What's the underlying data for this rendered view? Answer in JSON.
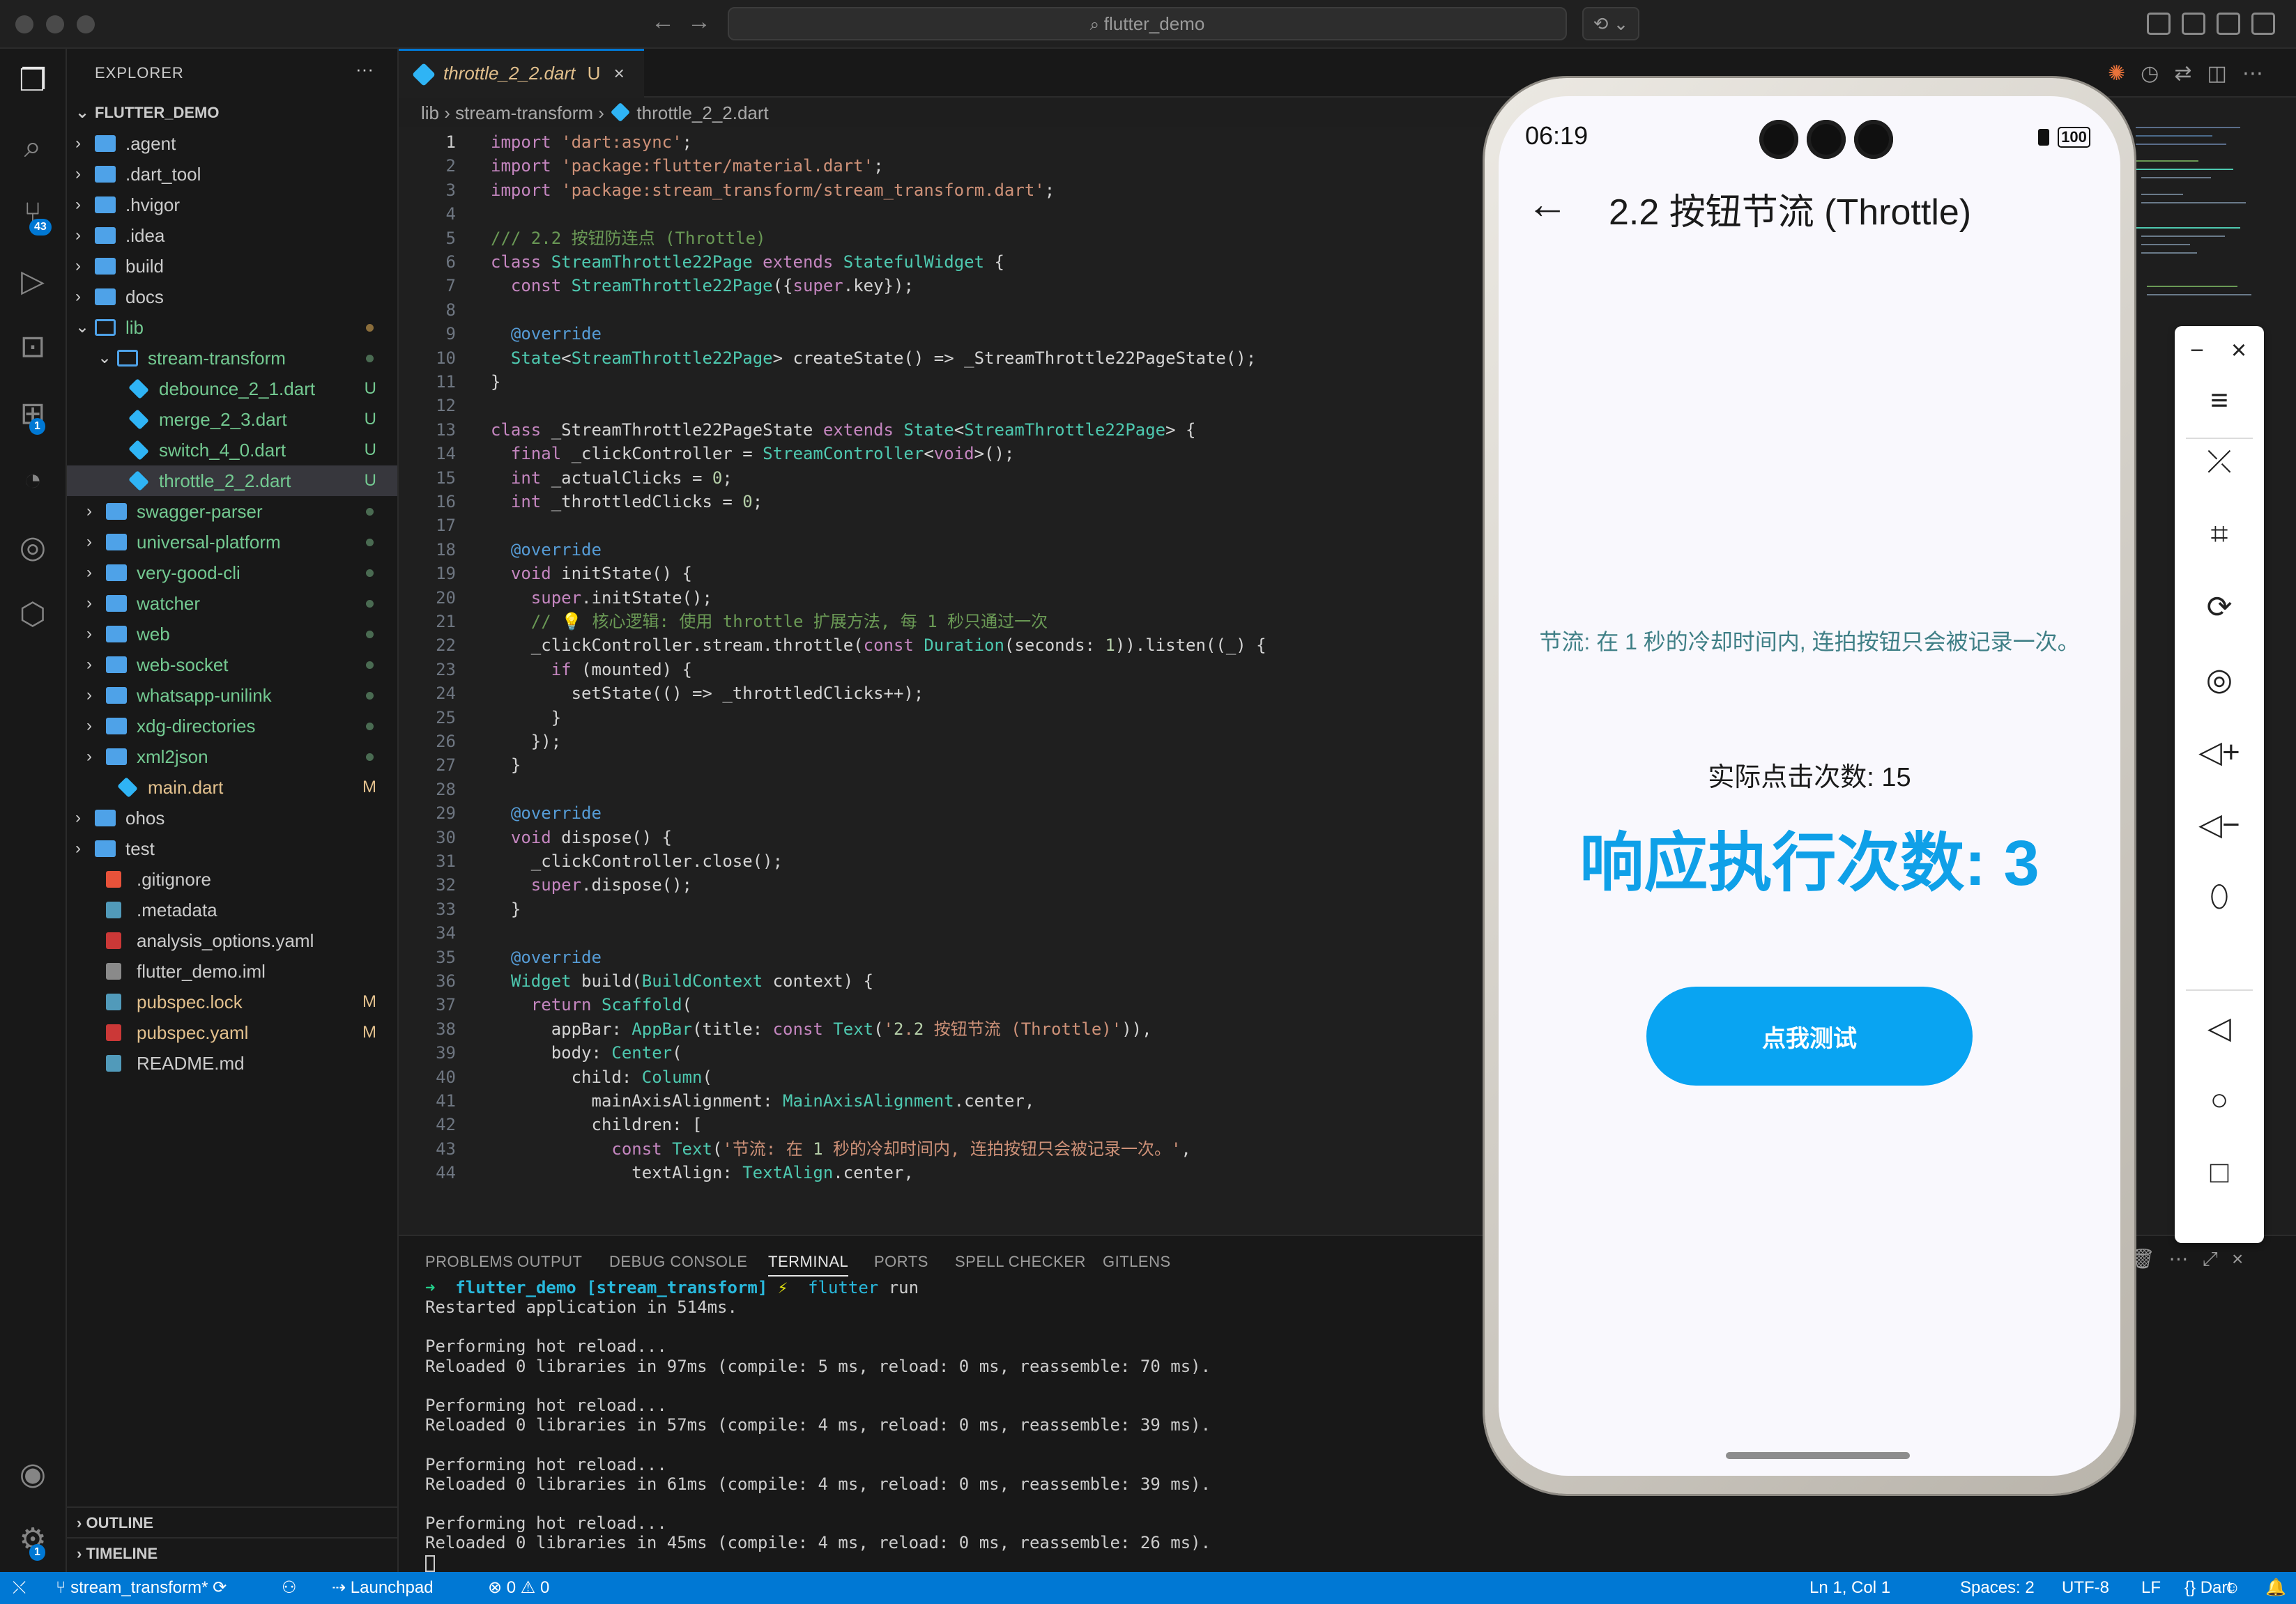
{
  "window": {
    "search": "flutter_demo"
  },
  "explorer": {
    "title": "EXPLORER",
    "more": "···",
    "root": "FLUTTER_DEMO",
    "items": [
      {
        "label": ".agent",
        "status": ""
      },
      {
        "label": ".dart_tool",
        "status": ""
      },
      {
        "label": ".hvigor",
        "status": ""
      },
      {
        "label": ".idea",
        "status": ""
      },
      {
        "label": "build",
        "status": ""
      },
      {
        "label": "docs",
        "status": ""
      },
      {
        "label": "lib",
        "status": ""
      },
      {
        "label": "stream-transform",
        "status": ""
      },
      {
        "label": "debounce_2_1.dart",
        "status": "U"
      },
      {
        "label": "merge_2_3.dart",
        "status": "U"
      },
      {
        "label": "switch_4_0.dart",
        "status": "U"
      },
      {
        "label": "throttle_2_2.dart",
        "status": "U"
      },
      {
        "label": "swagger-parser",
        "status": ""
      },
      {
        "label": "universal-platform",
        "status": ""
      },
      {
        "label": "very-good-cli",
        "status": ""
      },
      {
        "label": "watcher",
        "status": ""
      },
      {
        "label": "web",
        "status": ""
      },
      {
        "label": "web-socket",
        "status": ""
      },
      {
        "label": "whatsapp-unilink",
        "status": ""
      },
      {
        "label": "xdg-directories",
        "status": ""
      },
      {
        "label": "xml2json",
        "status": ""
      },
      {
        "label": "main.dart",
        "status": "M"
      },
      {
        "label": "ohos",
        "status": ""
      },
      {
        "label": "test",
        "status": ""
      },
      {
        "label": ".gitignore",
        "status": ""
      },
      {
        "label": ".metadata",
        "status": ""
      },
      {
        "label": "analysis_options.yaml",
        "status": ""
      },
      {
        "label": "flutter_demo.iml",
        "status": ""
      },
      {
        "label": "pubspec.lock",
        "status": "M"
      },
      {
        "label": "pubspec.yaml",
        "status": "M"
      },
      {
        "label": "README.md",
        "status": ""
      }
    ],
    "outline": "OUTLINE",
    "timeline": "TIMELINE"
  },
  "badges": {
    "scm": "43",
    "extensions": "1",
    "settings": "1"
  },
  "tab": {
    "name": "throttle_2_2.dart",
    "status": "U",
    "close": "×"
  },
  "breadcrumbs": {
    "b1": "lib",
    "b2": "stream-transform",
    "b3": "throttle_2_2.dart"
  },
  "code": [
    {
      "n": "1",
      "t": "import 'dart:async';"
    },
    {
      "n": "2",
      "t": "import 'package:flutter/material.dart';"
    },
    {
      "n": "3",
      "t": "import 'package:stream_transform/stream_transform.dart';"
    },
    {
      "n": "4",
      "t": ""
    },
    {
      "n": "5",
      "t": "/// 2.2 按钮防连点 (Throttle)"
    },
    {
      "n": "6",
      "t": "class StreamThrottle22Page extends StatefulWidget {"
    },
    {
      "n": "7",
      "t": "  const StreamThrottle22Page({super.key});"
    },
    {
      "n": "8",
      "t": ""
    },
    {
      "n": "9",
      "t": "  @override"
    },
    {
      "n": "10",
      "t": "  State<StreamThrottle22Page> createState() => _StreamThrottle22PageState();"
    },
    {
      "n": "11",
      "t": "}"
    },
    {
      "n": "12",
      "t": ""
    },
    {
      "n": "13",
      "t": "class _StreamThrottle22PageState extends State<StreamThrottle22Page> {"
    },
    {
      "n": "14",
      "t": "  final _clickController = StreamController<void>();"
    },
    {
      "n": "15",
      "t": "  int _actualClicks = 0;"
    },
    {
      "n": "16",
      "t": "  int _throttledClicks = 0;"
    },
    {
      "n": "17",
      "t": ""
    },
    {
      "n": "18",
      "t": "  @override"
    },
    {
      "n": "19",
      "t": "  void initState() {"
    },
    {
      "n": "20",
      "t": "    super.initState();"
    },
    {
      "n": "21",
      "t": "    // 💡 核心逻辑: 使用 throttle 扩展方法, 每 1 秒只通过一次"
    },
    {
      "n": "22",
      "t": "    _clickController.stream.throttle(const Duration(seconds: 1)).listen((_) {"
    },
    {
      "n": "23",
      "t": "      if (mounted) {"
    },
    {
      "n": "24",
      "t": "        setState(() => _throttledClicks++);"
    },
    {
      "n": "25",
      "t": "      }"
    },
    {
      "n": "26",
      "t": "    });"
    },
    {
      "n": "27",
      "t": "  }"
    },
    {
      "n": "28",
      "t": ""
    },
    {
      "n": "29",
      "t": "  @override"
    },
    {
      "n": "30",
      "t": "  void dispose() {"
    },
    {
      "n": "31",
      "t": "    _clickController.close();"
    },
    {
      "n": "32",
      "t": "    super.dispose();"
    },
    {
      "n": "33",
      "t": "  }"
    },
    {
      "n": "34",
      "t": ""
    },
    {
      "n": "35",
      "t": "  @override"
    },
    {
      "n": "36",
      "t": "  Widget build(BuildContext context) {"
    },
    {
      "n": "37",
      "t": "    return Scaffold("
    },
    {
      "n": "38",
      "t": "      appBar: AppBar(title: const Text('2.2 按钮节流 (Throttle)')),"
    },
    {
      "n": "39",
      "t": "      body: Center("
    },
    {
      "n": "40",
      "t": "        child: Column("
    },
    {
      "n": "41",
      "t": "          mainAxisAlignment: MainAxisAlignment.center,"
    },
    {
      "n": "42",
      "t": "          children: ["
    },
    {
      "n": "43",
      "t": "            const Text('节流: 在 1 秒的冷却时间内, 连拍按钮只会被记录一次。',"
    },
    {
      "n": "44",
      "t": "              textAlign: TextAlign.center,"
    }
  ],
  "panel": {
    "tabs": [
      "PROBLEMS",
      "OUTPUT",
      "DEBUG CONSOLE",
      "TERMINAL",
      "PORTS",
      "SPELL CHECKER",
      "GITLENS"
    ],
    "prompt_arrow": "➜",
    "prompt_dir": "flutter_demo",
    "prompt_branch": "[stream_transform]",
    "prompt_bolt": "⚡",
    "prompt_cmd": "flutter",
    "prompt_arg": "run",
    "lines": [
      "Restarted application in 514ms.",
      "",
      "Performing hot reload...",
      "Reloaded 0 libraries in 97ms (compile: 5 ms, reload: 0 ms, reassemble: 70 ms).",
      "",
      "Performing hot reload...",
      "Reloaded 0 libraries in 57ms (compile: 4 ms, reload: 0 ms, reassemble: 39 ms).",
      "",
      "Performing hot reload...",
      "Reloaded 0 libraries in 61ms (compile: 4 ms, reload: 0 ms, reassemble: 39 ms).",
      "",
      "Performing hot reload...",
      "Reloaded 0 libraries in 45ms (compile: 4 ms, reload: 0 ms, reassemble: 26 ms)."
    ]
  },
  "status": {
    "branch": "stream_transform*",
    "launchpad": "Launchpad",
    "errors": "0",
    "warnings": "0",
    "position": "Ln 1, Col 1",
    "spaces": "Spaces: 2",
    "encoding": "UTF-8",
    "eol": "LF",
    "language": "Dart"
  },
  "phone": {
    "time": "06:19",
    "battery": "100",
    "title": "2.2 按钮节流 (Throttle)",
    "description": "节流: 在 1 秒的冷却时间内, 连拍按钮只会被记录一次。",
    "actual_label": "实际点击次数: 15",
    "result_label": "响应执行次数: 3",
    "button": "点我测试"
  },
  "colors": {
    "accent": "#0078d4",
    "phone_button": "#09a4f2",
    "result_text": "#0fa0e8"
  }
}
